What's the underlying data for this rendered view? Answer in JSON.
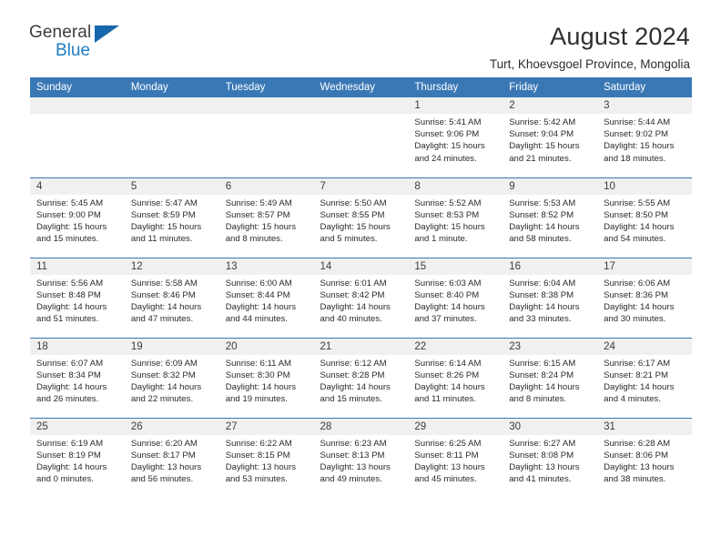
{
  "brand": {
    "name_part1": "General",
    "name_part2": "Blue",
    "triangle_icon": "triangle-icon",
    "accent_color": "#1f7ec4",
    "triangle_color": "#1667ab"
  },
  "header": {
    "title": "August 2024",
    "subtitle": "Turt, Khoevsgoel Province, Mongolia"
  },
  "calendar": {
    "header_bg": "#3a78b5",
    "header_text_color": "#ffffff",
    "daynum_bg": "#f0f0f0",
    "weekdays": [
      "Sunday",
      "Monday",
      "Tuesday",
      "Wednesday",
      "Thursday",
      "Friday",
      "Saturday"
    ],
    "weeks": [
      [
        {
          "day": "",
          "blank": true,
          "sunrise": "",
          "sunset": "",
          "daylight_line1": "",
          "daylight_line2": ""
        },
        {
          "day": "",
          "blank": true,
          "sunrise": "",
          "sunset": "",
          "daylight_line1": "",
          "daylight_line2": ""
        },
        {
          "day": "",
          "blank": true,
          "sunrise": "",
          "sunset": "",
          "daylight_line1": "",
          "daylight_line2": ""
        },
        {
          "day": "",
          "blank": true,
          "sunrise": "",
          "sunset": "",
          "daylight_line1": "",
          "daylight_line2": ""
        },
        {
          "day": "1",
          "blank": false,
          "sunrise": "Sunrise: 5:41 AM",
          "sunset": "Sunset: 9:06 PM",
          "daylight_line1": "Daylight: 15 hours",
          "daylight_line2": "and 24 minutes."
        },
        {
          "day": "2",
          "blank": false,
          "sunrise": "Sunrise: 5:42 AM",
          "sunset": "Sunset: 9:04 PM",
          "daylight_line1": "Daylight: 15 hours",
          "daylight_line2": "and 21 minutes."
        },
        {
          "day": "3",
          "blank": false,
          "sunrise": "Sunrise: 5:44 AM",
          "sunset": "Sunset: 9:02 PM",
          "daylight_line1": "Daylight: 15 hours",
          "daylight_line2": "and 18 minutes."
        }
      ],
      [
        {
          "day": "4",
          "blank": false,
          "sunrise": "Sunrise: 5:45 AM",
          "sunset": "Sunset: 9:00 PM",
          "daylight_line1": "Daylight: 15 hours",
          "daylight_line2": "and 15 minutes."
        },
        {
          "day": "5",
          "blank": false,
          "sunrise": "Sunrise: 5:47 AM",
          "sunset": "Sunset: 8:59 PM",
          "daylight_line1": "Daylight: 15 hours",
          "daylight_line2": "and 11 minutes."
        },
        {
          "day": "6",
          "blank": false,
          "sunrise": "Sunrise: 5:49 AM",
          "sunset": "Sunset: 8:57 PM",
          "daylight_line1": "Daylight: 15 hours",
          "daylight_line2": "and 8 minutes."
        },
        {
          "day": "7",
          "blank": false,
          "sunrise": "Sunrise: 5:50 AM",
          "sunset": "Sunset: 8:55 PM",
          "daylight_line1": "Daylight: 15 hours",
          "daylight_line2": "and 5 minutes."
        },
        {
          "day": "8",
          "blank": false,
          "sunrise": "Sunrise: 5:52 AM",
          "sunset": "Sunset: 8:53 PM",
          "daylight_line1": "Daylight: 15 hours",
          "daylight_line2": "and 1 minute."
        },
        {
          "day": "9",
          "blank": false,
          "sunrise": "Sunrise: 5:53 AM",
          "sunset": "Sunset: 8:52 PM",
          "daylight_line1": "Daylight: 14 hours",
          "daylight_line2": "and 58 minutes."
        },
        {
          "day": "10",
          "blank": false,
          "sunrise": "Sunrise: 5:55 AM",
          "sunset": "Sunset: 8:50 PM",
          "daylight_line1": "Daylight: 14 hours",
          "daylight_line2": "and 54 minutes."
        }
      ],
      [
        {
          "day": "11",
          "blank": false,
          "sunrise": "Sunrise: 5:56 AM",
          "sunset": "Sunset: 8:48 PM",
          "daylight_line1": "Daylight: 14 hours",
          "daylight_line2": "and 51 minutes."
        },
        {
          "day": "12",
          "blank": false,
          "sunrise": "Sunrise: 5:58 AM",
          "sunset": "Sunset: 8:46 PM",
          "daylight_line1": "Daylight: 14 hours",
          "daylight_line2": "and 47 minutes."
        },
        {
          "day": "13",
          "blank": false,
          "sunrise": "Sunrise: 6:00 AM",
          "sunset": "Sunset: 8:44 PM",
          "daylight_line1": "Daylight: 14 hours",
          "daylight_line2": "and 44 minutes."
        },
        {
          "day": "14",
          "blank": false,
          "sunrise": "Sunrise: 6:01 AM",
          "sunset": "Sunset: 8:42 PM",
          "daylight_line1": "Daylight: 14 hours",
          "daylight_line2": "and 40 minutes."
        },
        {
          "day": "15",
          "blank": false,
          "sunrise": "Sunrise: 6:03 AM",
          "sunset": "Sunset: 8:40 PM",
          "daylight_line1": "Daylight: 14 hours",
          "daylight_line2": "and 37 minutes."
        },
        {
          "day": "16",
          "blank": false,
          "sunrise": "Sunrise: 6:04 AM",
          "sunset": "Sunset: 8:38 PM",
          "daylight_line1": "Daylight: 14 hours",
          "daylight_line2": "and 33 minutes."
        },
        {
          "day": "17",
          "blank": false,
          "sunrise": "Sunrise: 6:06 AM",
          "sunset": "Sunset: 8:36 PM",
          "daylight_line1": "Daylight: 14 hours",
          "daylight_line2": "and 30 minutes."
        }
      ],
      [
        {
          "day": "18",
          "blank": false,
          "sunrise": "Sunrise: 6:07 AM",
          "sunset": "Sunset: 8:34 PM",
          "daylight_line1": "Daylight: 14 hours",
          "daylight_line2": "and 26 minutes."
        },
        {
          "day": "19",
          "blank": false,
          "sunrise": "Sunrise: 6:09 AM",
          "sunset": "Sunset: 8:32 PM",
          "daylight_line1": "Daylight: 14 hours",
          "daylight_line2": "and 22 minutes."
        },
        {
          "day": "20",
          "blank": false,
          "sunrise": "Sunrise: 6:11 AM",
          "sunset": "Sunset: 8:30 PM",
          "daylight_line1": "Daylight: 14 hours",
          "daylight_line2": "and 19 minutes."
        },
        {
          "day": "21",
          "blank": false,
          "sunrise": "Sunrise: 6:12 AM",
          "sunset": "Sunset: 8:28 PM",
          "daylight_line1": "Daylight: 14 hours",
          "daylight_line2": "and 15 minutes."
        },
        {
          "day": "22",
          "blank": false,
          "sunrise": "Sunrise: 6:14 AM",
          "sunset": "Sunset: 8:26 PM",
          "daylight_line1": "Daylight: 14 hours",
          "daylight_line2": "and 11 minutes."
        },
        {
          "day": "23",
          "blank": false,
          "sunrise": "Sunrise: 6:15 AM",
          "sunset": "Sunset: 8:24 PM",
          "daylight_line1": "Daylight: 14 hours",
          "daylight_line2": "and 8 minutes."
        },
        {
          "day": "24",
          "blank": false,
          "sunrise": "Sunrise: 6:17 AM",
          "sunset": "Sunset: 8:21 PM",
          "daylight_line1": "Daylight: 14 hours",
          "daylight_line2": "and 4 minutes."
        }
      ],
      [
        {
          "day": "25",
          "blank": false,
          "sunrise": "Sunrise: 6:19 AM",
          "sunset": "Sunset: 8:19 PM",
          "daylight_line1": "Daylight: 14 hours",
          "daylight_line2": "and 0 minutes."
        },
        {
          "day": "26",
          "blank": false,
          "sunrise": "Sunrise: 6:20 AM",
          "sunset": "Sunset: 8:17 PM",
          "daylight_line1": "Daylight: 13 hours",
          "daylight_line2": "and 56 minutes."
        },
        {
          "day": "27",
          "blank": false,
          "sunrise": "Sunrise: 6:22 AM",
          "sunset": "Sunset: 8:15 PM",
          "daylight_line1": "Daylight: 13 hours",
          "daylight_line2": "and 53 minutes."
        },
        {
          "day": "28",
          "blank": false,
          "sunrise": "Sunrise: 6:23 AM",
          "sunset": "Sunset: 8:13 PM",
          "daylight_line1": "Daylight: 13 hours",
          "daylight_line2": "and 49 minutes."
        },
        {
          "day": "29",
          "blank": false,
          "sunrise": "Sunrise: 6:25 AM",
          "sunset": "Sunset: 8:11 PM",
          "daylight_line1": "Daylight: 13 hours",
          "daylight_line2": "and 45 minutes."
        },
        {
          "day": "30",
          "blank": false,
          "sunrise": "Sunrise: 6:27 AM",
          "sunset": "Sunset: 8:08 PM",
          "daylight_line1": "Daylight: 13 hours",
          "daylight_line2": "and 41 minutes."
        },
        {
          "day": "31",
          "blank": false,
          "sunrise": "Sunrise: 6:28 AM",
          "sunset": "Sunset: 8:06 PM",
          "daylight_line1": "Daylight: 13 hours",
          "daylight_line2": "and 38 minutes."
        }
      ]
    ]
  }
}
